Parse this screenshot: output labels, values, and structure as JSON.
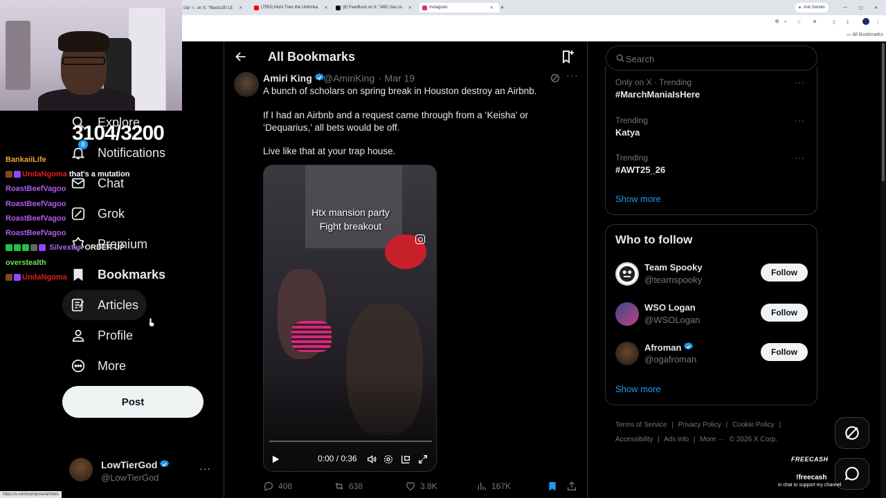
{
  "browser": {
    "tabs": [
      {
        "label": "clip 🐀 on X: \"Wack100 LE",
        "fav_color": "#555"
      },
      {
        "label": "(7553) Mom Tries the Unthinka",
        "fav_color": "#ff0000"
      },
      {
        "label": "(8) FearBuck on X: \"ABC has co",
        "fav_color": "#111"
      },
      {
        "label": "Instagram",
        "fav_color": "#e1306c"
      }
    ],
    "ask_gemini": "Ask Gemini",
    "bookmarks_folder": "All Bookmarks",
    "status_url": "https://x.com/compose/articles"
  },
  "overlay": {
    "sub_counter": "3104/3200",
    "notification_badge": "8",
    "chat": [
      {
        "user": "BankaiiLife",
        "user_color": "#f0a431",
        "msg": ""
      },
      {
        "user": "UndaNgoma",
        "user_color": "#e0201d",
        "msg": "that's a mutation"
      },
      {
        "user": "RoastBeefVagoo",
        "user_color": "#b05cf0",
        "msg": ""
      },
      {
        "user": "RoastBeefVagoo",
        "user_color": "#b05cf0",
        "msg": ""
      },
      {
        "user": "RoastBeefVagoo",
        "user_color": "#b05cf0",
        "msg": ""
      },
      {
        "user": "RoastBeefVagoo",
        "user_color": "#b05cf0",
        "msg": ""
      },
      {
        "user": "Silvextan",
        "user_color": "#9e6df0",
        "msg": "ORDER UP"
      },
      {
        "user": "overstealth",
        "user_color": "#6ee05a",
        "msg": ""
      },
      {
        "user": "UndaNgoma",
        "user_color": "#e0201d",
        "msg": ""
      }
    ],
    "freecash_logo": "FREECASH",
    "freecash_cmd": "!freecash",
    "freecash_sub": "in chat to support my channel"
  },
  "sidebar": {
    "items": [
      {
        "label": "Explore",
        "icon": "search-icon"
      },
      {
        "label": "Notifications",
        "icon": "bell-icon"
      },
      {
        "label": "Chat",
        "icon": "mail-icon"
      },
      {
        "label": "Grok",
        "icon": "grok-icon"
      },
      {
        "label": "Premium",
        "icon": "premium-icon"
      },
      {
        "label": "Bookmarks",
        "icon": "bookmark-icon"
      },
      {
        "label": "Articles",
        "icon": "article-icon"
      },
      {
        "label": "Profile",
        "icon": "person-icon"
      },
      {
        "label": "More",
        "icon": "more-circle-icon"
      }
    ],
    "post_label": "Post",
    "account": {
      "name": "LowTierGod",
      "handle": "@LowTierGod",
      "more": "···"
    }
  },
  "main": {
    "title": "All Bookmarks",
    "tweet": {
      "author": "Amiri King",
      "handle": "@AmiriKing",
      "time": "· Mar 19",
      "more": "···",
      "text": [
        "A bunch of scholars on spring break in Houston destroy an Airbnb.",
        "If I had an Airbnb and a request came through from a ‘Keisha’ or",
        "‘Dequarius,’ all bets would be off.",
        "Live like that at your trap house."
      ],
      "video": {
        "caption_line1": "Htx mansion party",
        "caption_line2": "Fight breakout",
        "time": "0:00 / 0:36",
        "progress": 0
      },
      "stats": {
        "replies": "408",
        "reposts": "638",
        "likes": "3.8K",
        "views": "167K"
      }
    }
  },
  "right": {
    "search_placeholder": "Search",
    "trends": [
      {
        "meta": "Only on X · Trending",
        "name": "#MarchManiaIsHere"
      },
      {
        "meta": "Trending",
        "name": "Katya"
      },
      {
        "meta": "Trending",
        "name": "#AWT25_26"
      }
    ],
    "dots": "···",
    "show_more": "Show more",
    "who_to_follow": {
      "title": "Who to follow",
      "accounts": [
        {
          "name": "Team Spooky",
          "handle": "@teamspooky",
          "verified": false
        },
        {
          "name": "WSO Logan",
          "handle": "@WSOLogan",
          "verified": false
        },
        {
          "name": "Afroman",
          "handle": "@ogafroman",
          "verified": true
        }
      ],
      "follow_label": "Follow",
      "show_more": "Show more"
    },
    "footer": {
      "links": [
        "Terms of Service",
        "|",
        "Privacy Policy",
        "|",
        "Cookie Policy",
        "|",
        "Accessibility",
        "|",
        "Ads info",
        "|",
        "More ···",
        "© 2026 X Corp."
      ]
    }
  },
  "colors": {
    "accent": "#1d9bf0",
    "bg": "#000000",
    "border": "#2f3336",
    "muted": "#71767b"
  }
}
